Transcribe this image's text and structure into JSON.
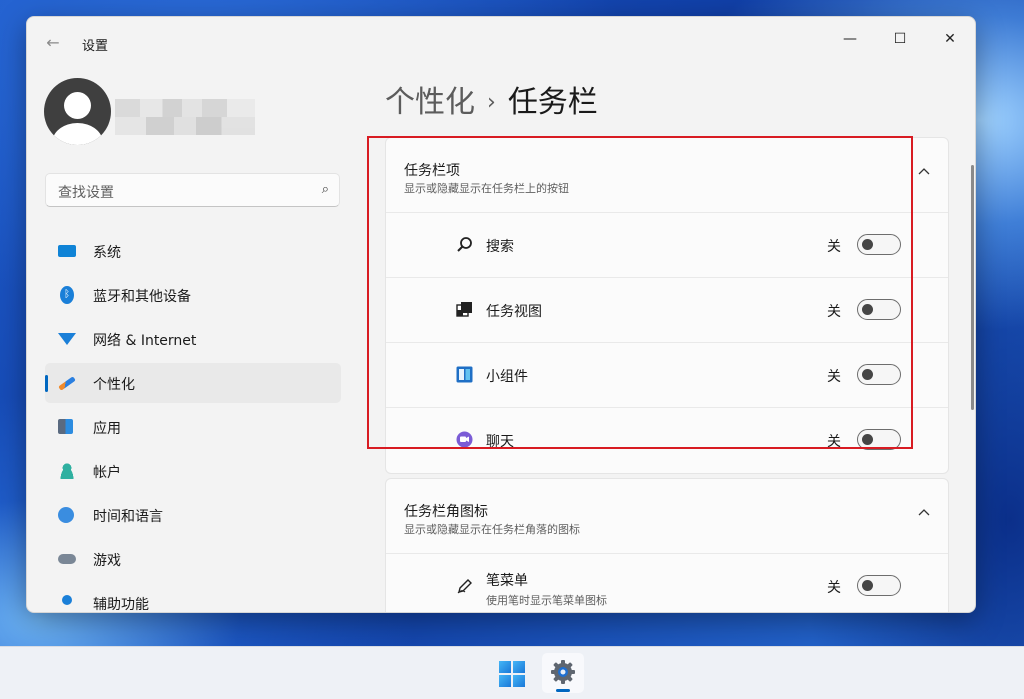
{
  "window": {
    "app_title": "设置",
    "controls": {
      "minimize": "—",
      "maximize": "☐",
      "close": "✕"
    }
  },
  "search": {
    "placeholder": "查找设置"
  },
  "sidebar": {
    "items": [
      {
        "label": "系统",
        "icon": "monitor-icon"
      },
      {
        "label": "蓝牙和其他设备",
        "icon": "bluetooth-icon"
      },
      {
        "label": "网络 & Internet",
        "icon": "wifi-icon"
      },
      {
        "label": "个性化",
        "icon": "brush-icon",
        "active": true
      },
      {
        "label": "应用",
        "icon": "apps-icon"
      },
      {
        "label": "帐户",
        "icon": "account-icon"
      },
      {
        "label": "时间和语言",
        "icon": "clock-globe-icon"
      },
      {
        "label": "游戏",
        "icon": "gamepad-icon"
      },
      {
        "label": "辅助功能",
        "icon": "accessibility-icon"
      }
    ]
  },
  "breadcrumb": {
    "parent": "个性化",
    "separator": "›",
    "current": "任务栏"
  },
  "taskbar_items": {
    "title": "任务栏项",
    "subtitle": "显示或隐藏显示在任务栏上的按钮",
    "rows": [
      {
        "label": "搜索",
        "icon": "search-icon",
        "state": "关"
      },
      {
        "label": "任务视图",
        "icon": "task-view-icon",
        "state": "关"
      },
      {
        "label": "小组件",
        "icon": "widgets-icon",
        "state": "关"
      },
      {
        "label": "聊天",
        "icon": "chat-icon",
        "state": "关"
      }
    ]
  },
  "corner_icons": {
    "title": "任务栏角图标",
    "subtitle": "显示或隐藏显示在任务栏角落的图标",
    "rows": [
      {
        "label": "笔菜单",
        "sublabel": "使用笔时显示笔菜单图标",
        "icon": "pen-icon",
        "state": "关"
      }
    ]
  },
  "colors": {
    "accent": "#0067c0",
    "highlight_border": "#d81b22"
  }
}
